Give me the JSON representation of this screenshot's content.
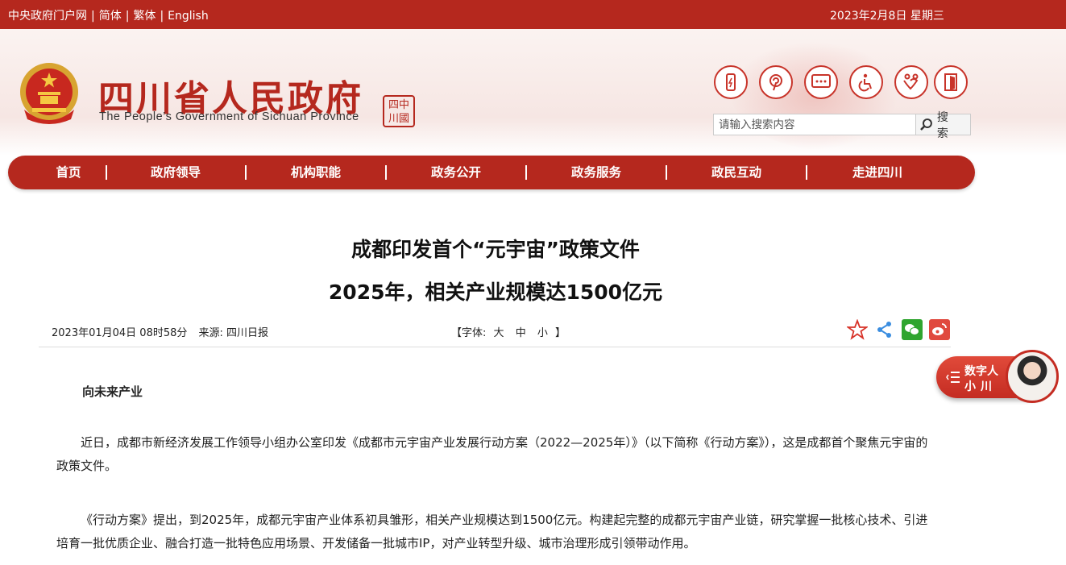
{
  "topbar": {
    "links": [
      "中央政府门户网",
      "简体",
      "繁体",
      "English"
    ],
    "date": "2023年2月8日  星期三"
  },
  "header": {
    "title": "四川省人民政府",
    "subtitle": "The People’s Government of Sichuan Province",
    "seal_text_top": "四中",
    "seal_text_bottom": "川國"
  },
  "search": {
    "placeholder": "请输入搜索内容",
    "button_label": "搜 索"
  },
  "nav": {
    "items": [
      "首页",
      "政府领导",
      "机构职能",
      "政务公开",
      "政务服务",
      "政民互动",
      "走进四川"
    ]
  },
  "article": {
    "title_line1": "成都印发首个“元宇宙”政策文件",
    "title_line2": "2025年，相关产业规模达1500亿元",
    "date": "2023年01月04日 08时58分",
    "source": "来源: 四川日报",
    "font_label": "【字体:",
    "font_options": [
      "大",
      "中",
      "小"
    ],
    "font_close": "】",
    "subheading": "向未来产业",
    "paragraphs": [
      "近日，成都市新经济发展工作领导小组办公室印发《成都市元宇宙产业发展行动方案（2022—2025年）》（以下简称《行动方案》），这是成都首个聚焦元宇宙的政策文件。",
      "《行动方案》提出，到2025年，成都元宇宙产业体系初具雏形，相关产业规模达到1500亿元。构建起完整的成都元宇宙产业链，研究掌握一批核心技术、引进培育一批优质企业、融合打造一批特色应用场景、开发储备一批城市IP，对产业转型升级、城市治理形成引领带动作用。"
    ]
  },
  "assistant": {
    "line1": "数字人",
    "line2": "小川"
  },
  "colors": {
    "brand_red": "#b5281e",
    "wechat_green": "#2fa52f",
    "weibo_red": "#e0493e",
    "share_blue": "#3a8de0"
  }
}
